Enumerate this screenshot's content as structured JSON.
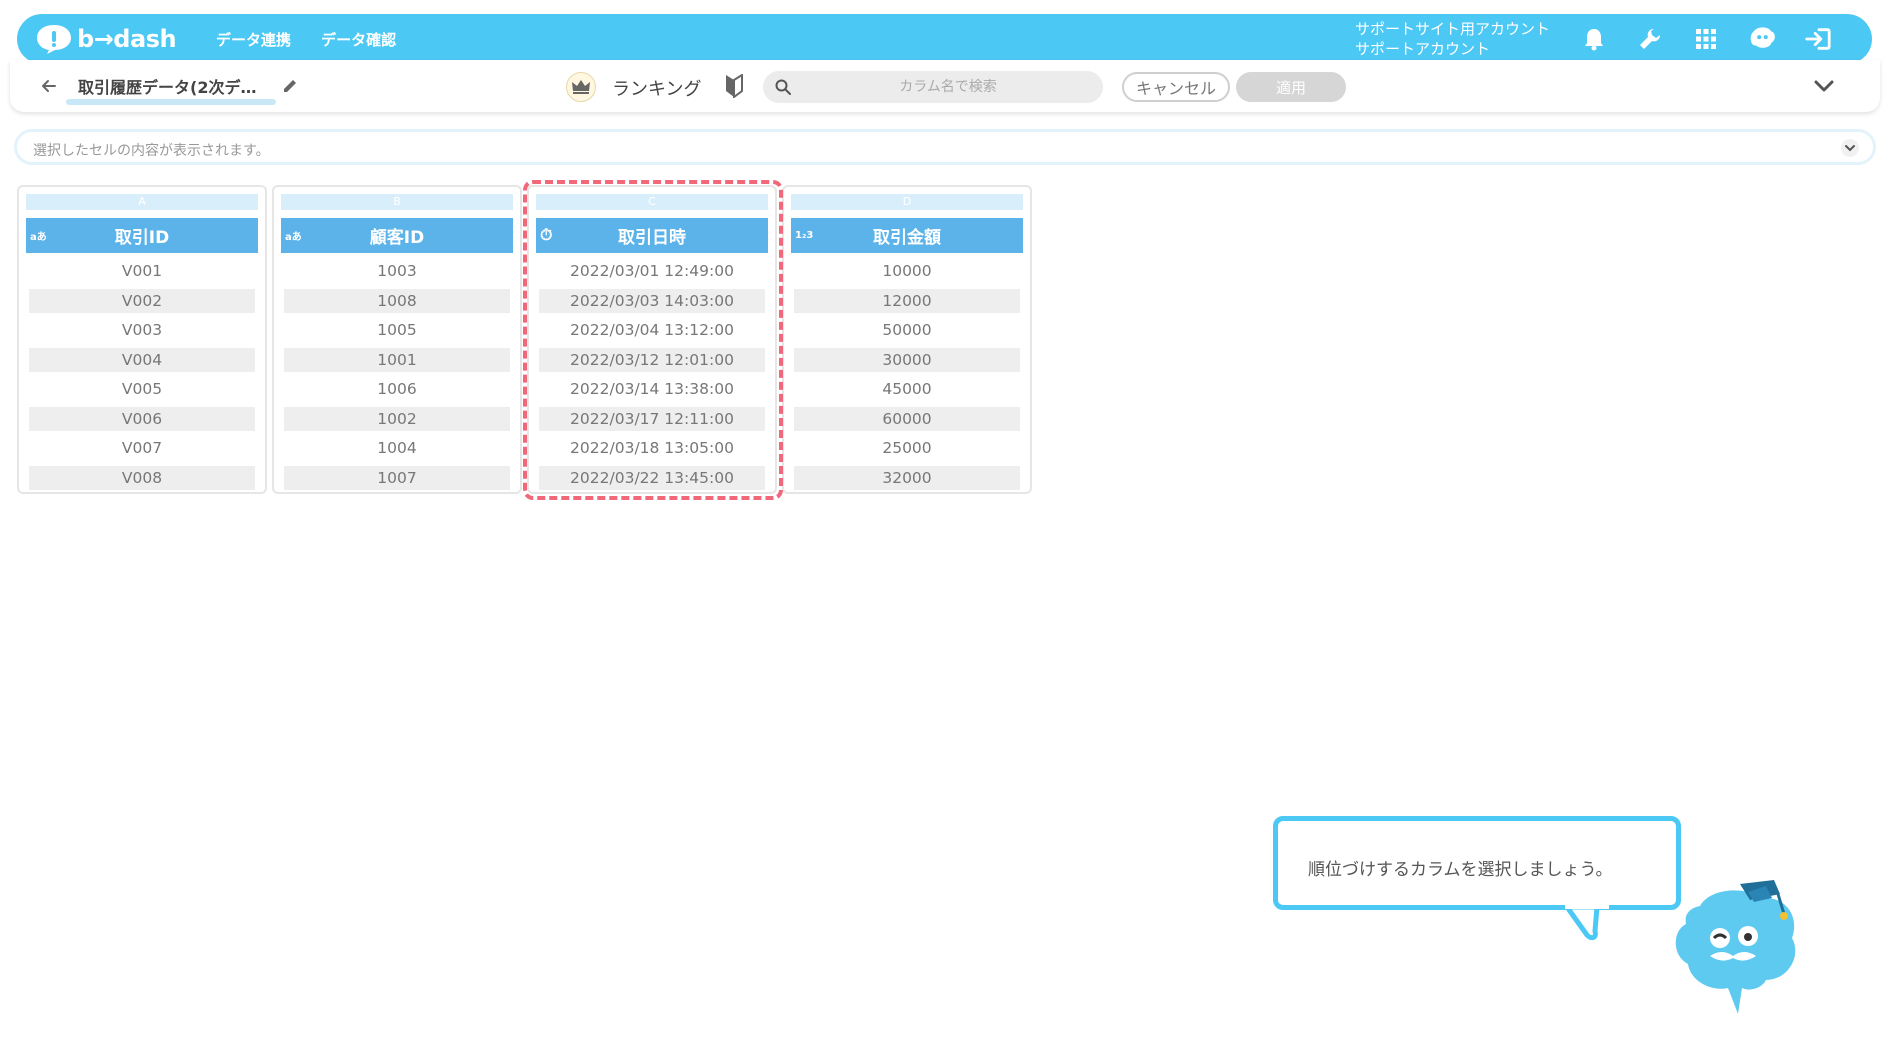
{
  "app": {
    "brand": "b→dash",
    "nav": [
      "データ連携",
      "データ確認"
    ],
    "account_line1": "サポートサイト用アカウント",
    "account_line2": "サポートアカウント",
    "icons": [
      "bell-icon",
      "wrench-icon",
      "grid-icon",
      "mascot-icon",
      "logout-icon"
    ],
    "accent_color": "#4cc8f4"
  },
  "header": {
    "title": "取引履歴データ(2次デ…",
    "mode_label": "ランキング",
    "search_placeholder": "カラム名で検索",
    "cancel_label": "キャンセル",
    "apply_label": "適用"
  },
  "cellbar": {
    "placeholder": "選択したセルの内容が表示されます。"
  },
  "table": {
    "columns": [
      {
        "letter": "A",
        "type": "aあ",
        "header": "取引ID"
      },
      {
        "letter": "B",
        "type": "aあ",
        "header": "顧客ID"
      },
      {
        "letter": "C",
        "type": "⏱",
        "header": "取引日時"
      },
      {
        "letter": "D",
        "type": "1₂3",
        "header": "取引金額"
      }
    ],
    "rows": [
      [
        "V001",
        "1003",
        "2022/03/01 12:49:00",
        "10000"
      ],
      [
        "V002",
        "1008",
        "2022/03/03 14:03:00",
        "12000"
      ],
      [
        "V003",
        "1005",
        "2022/03/04 13:12:00",
        "50000"
      ],
      [
        "V004",
        "1001",
        "2022/03/12 12:01:00",
        "30000"
      ],
      [
        "V005",
        "1006",
        "2022/03/14 13:38:00",
        "45000"
      ],
      [
        "V006",
        "1002",
        "2022/03/17 12:11:00",
        "60000"
      ],
      [
        "V007",
        "1004",
        "2022/03/18 13:05:00",
        "25000"
      ],
      [
        "V008",
        "1007",
        "2022/03/22 13:45:00",
        "32000"
      ]
    ]
  },
  "tooltip": {
    "text": "順位づけするカラムを選択しましょう。"
  }
}
